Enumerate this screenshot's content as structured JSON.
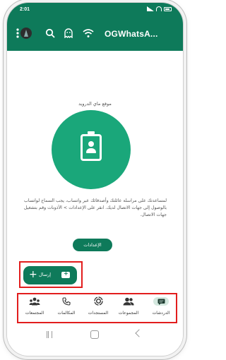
{
  "status": {
    "time": "2:01"
  },
  "appbar": {
    "title": "OGWhatsA..."
  },
  "empty_state": {
    "heading": "موقع ماي الدرويد",
    "body": "لمساعدتك على مراسلة عائلتك وأصدقائك عبر واتساب، يجب السماح لواتساب بالوصول إلى جهات الاتصال لديك. انقر على الإعدادات > الأذونات وقم بتشغيل جهات الاتصال.",
    "settings_button": "الإعدادات"
  },
  "fab": {
    "label": "إرسال",
    "plus": "+"
  },
  "nav": {
    "items": [
      {
        "label": "الدردشات",
        "icon": "chats-icon"
      },
      {
        "label": "المجموعات",
        "icon": "groups-icon"
      },
      {
        "label": "المستجدات",
        "icon": "updates-icon"
      },
      {
        "label": "المكالمات",
        "icon": "calls-icon"
      },
      {
        "label": "المجتمعات",
        "icon": "communities-icon"
      }
    ]
  },
  "colors": {
    "primary": "#0e7a5a",
    "circle": "#1aa77a",
    "highlight": "#e21d1d",
    "active_pill": "#d4e8df"
  }
}
